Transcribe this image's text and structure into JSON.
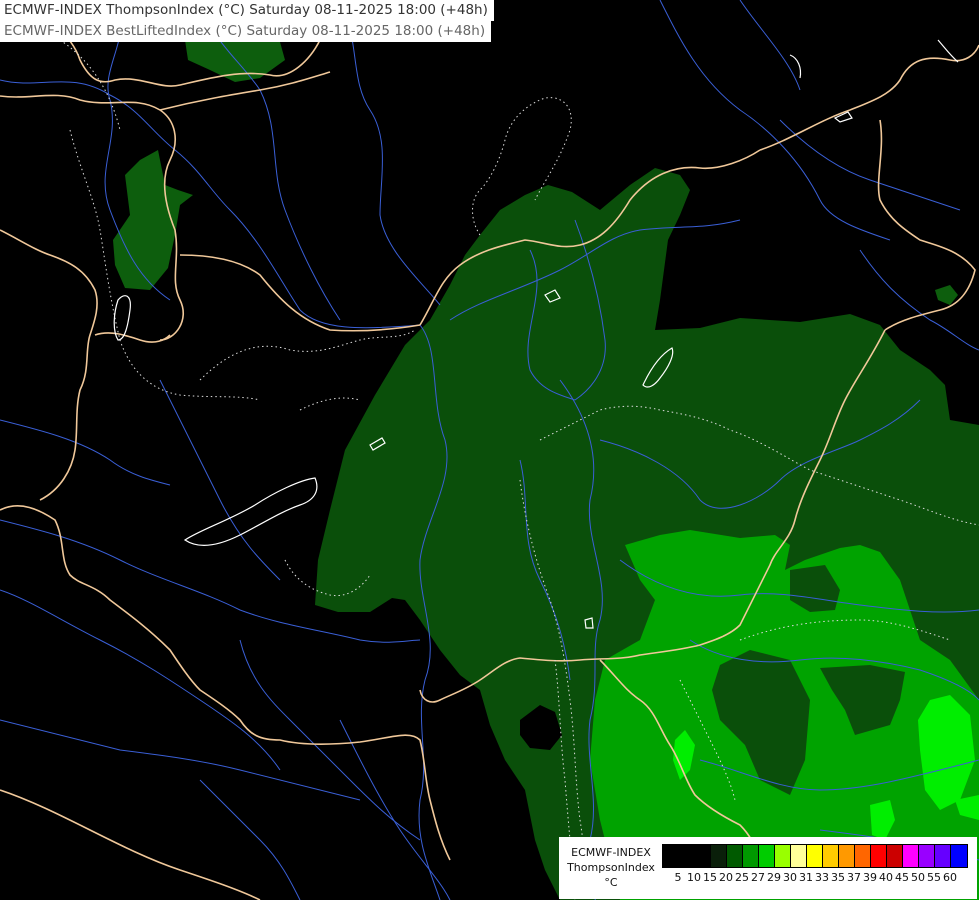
{
  "title": {
    "line1": "ECMWF-INDEX ThompsonIndex (°C) Saturday 08-11-2025 18:00 (+48h)",
    "line2": "ECMWF-INDEX BestLiftedIndex (°C) Saturday 08-11-2025 18:00 (+48h)"
  },
  "legend": {
    "line1": "ECMWF-INDEX",
    "line2": "ThompsonIndex",
    "line3": "°C",
    "ticks": [
      "5",
      "10",
      "15",
      "20",
      "25",
      "27",
      "29",
      "30",
      "31",
      "33",
      "35",
      "37",
      "39",
      "40",
      "45",
      "50",
      "55",
      "60"
    ],
    "colors": [
      "#000000",
      "#000000",
      "#000000",
      "#0a1f0a",
      "#005a00",
      "#009900",
      "#00cc00",
      "#99ff00",
      "#ffff99",
      "#ffff00",
      "#ffcc00",
      "#ff9900",
      "#ff6600",
      "#ff0000",
      "#cc0000",
      "#ff00ff",
      "#9900ff",
      "#6600ff",
      "#0000ff"
    ]
  },
  "colors": {
    "background": "#000000",
    "border": "#f0c89a",
    "river": "#3a5fd6",
    "zone_dark": "#0a4d0a",
    "zone_mid": "#006600",
    "zone_bright": "#00bb00",
    "zone_neon": "#00ff00",
    "contour": "#ffffff"
  }
}
